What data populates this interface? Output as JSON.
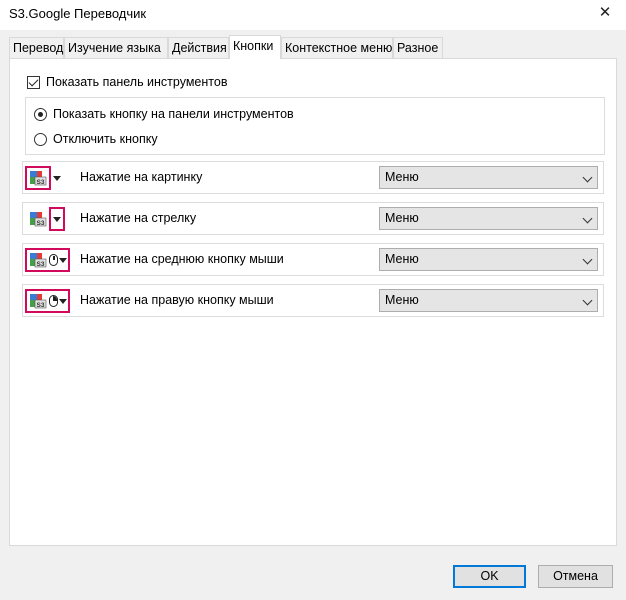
{
  "window": {
    "title": "S3.Google Переводчик",
    "close_glyph": "✕"
  },
  "tabs": [
    {
      "label": "Перевод",
      "active": false
    },
    {
      "label": "Изучение языка",
      "active": false
    },
    {
      "label": "Действия",
      "active": false
    },
    {
      "label": "Кнопки",
      "active": true
    },
    {
      "label": "Контекстное меню",
      "active": false
    },
    {
      "label": "Разное",
      "active": false
    }
  ],
  "toolbar_option": {
    "label": "Показать панель инструментов",
    "checked": true
  },
  "radio_options": [
    {
      "label": "Показать кнопку на панели инструментов",
      "selected": true
    },
    {
      "label": "Отключить кнопку",
      "selected": false
    }
  ],
  "actions": [
    {
      "label": "Нажатие на картинку",
      "value": "Меню",
      "icon": "s3-logo-icon",
      "highlight": "icon"
    },
    {
      "label": "Нажатие на стрелку",
      "value": "Меню",
      "icon": "s3-logo-icon",
      "highlight": "arrow"
    },
    {
      "label": "Нажатие на среднюю кнопку мыши",
      "value": "Меню",
      "icon": "middle-mouse-icon",
      "highlight": "all"
    },
    {
      "label": "Нажатие на правую кнопку мыши",
      "value": "Меню",
      "icon": "right-mouse-icon",
      "highlight": "all"
    }
  ],
  "buttons": {
    "ok": "OK",
    "cancel": "Отмена"
  },
  "colors": {
    "highlight": "#d10a5c",
    "accent": "#0078d7"
  }
}
